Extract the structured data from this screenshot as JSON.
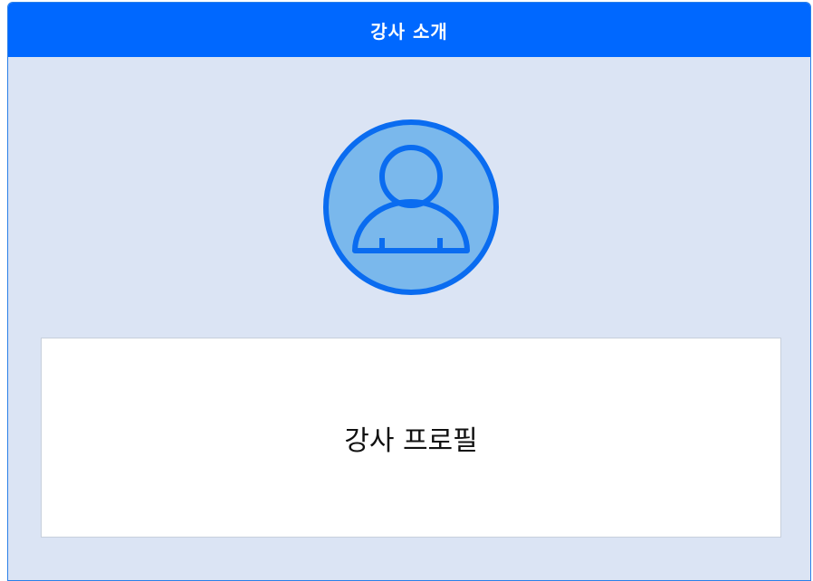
{
  "panel": {
    "title": "강사 소개",
    "avatar_icon": "user-avatar-icon",
    "profile_text": "강사 프로필"
  },
  "colors": {
    "header_bg": "#0068ff",
    "panel_bg": "#dbe4f4",
    "avatar_fill": "#7ab8ec",
    "avatar_stroke": "#0a6cf0"
  }
}
